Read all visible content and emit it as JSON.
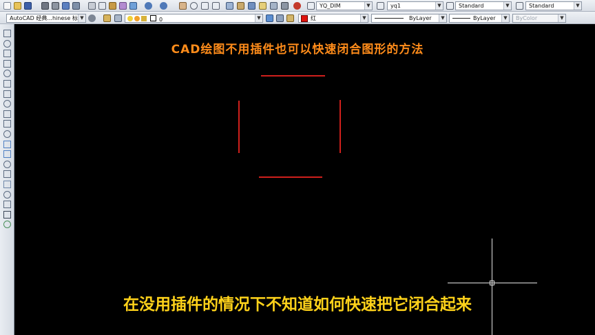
{
  "app": {
    "workspace_label": "AutoCAD 经典...hinese 标准",
    "layer_value": "0",
    "dim_style": "YQ_DIM",
    "text_style": "yq1",
    "table_style": "Standard",
    "multileader_style": "Standard",
    "color_value": "红",
    "linetype_value": "ByLayer",
    "lineweight_value": "ByLayer",
    "plotstyle_value": "ByColor"
  },
  "canvas": {
    "title": "CAD绘图不用插件也可以快速闭合图形的方法",
    "subtitle": "在没用插件的情况下不知道如何快速把它闭合起来"
  },
  "colors": {
    "title": "#ff8c1a",
    "subtitle": "#ffd21a",
    "drawing_lines": "#d0201c",
    "crosshair": "#e6e6e6",
    "canvas_bg": "#000000"
  },
  "icons": {
    "left_toolbar": [
      "line-icon",
      "construction-line-icon",
      "polyline-icon",
      "polygon-icon",
      "rectangle-icon",
      "arc-icon",
      "circle-icon",
      "revision-cloud-icon",
      "spline-icon",
      "ellipse-icon",
      "ellipse-arc-icon",
      "insert-block-icon",
      "make-block-icon",
      "point-icon",
      "hatch-icon",
      "gradient-icon",
      "region-icon",
      "table-icon",
      "multiline-text-icon",
      "add-selected-icon"
    ]
  }
}
